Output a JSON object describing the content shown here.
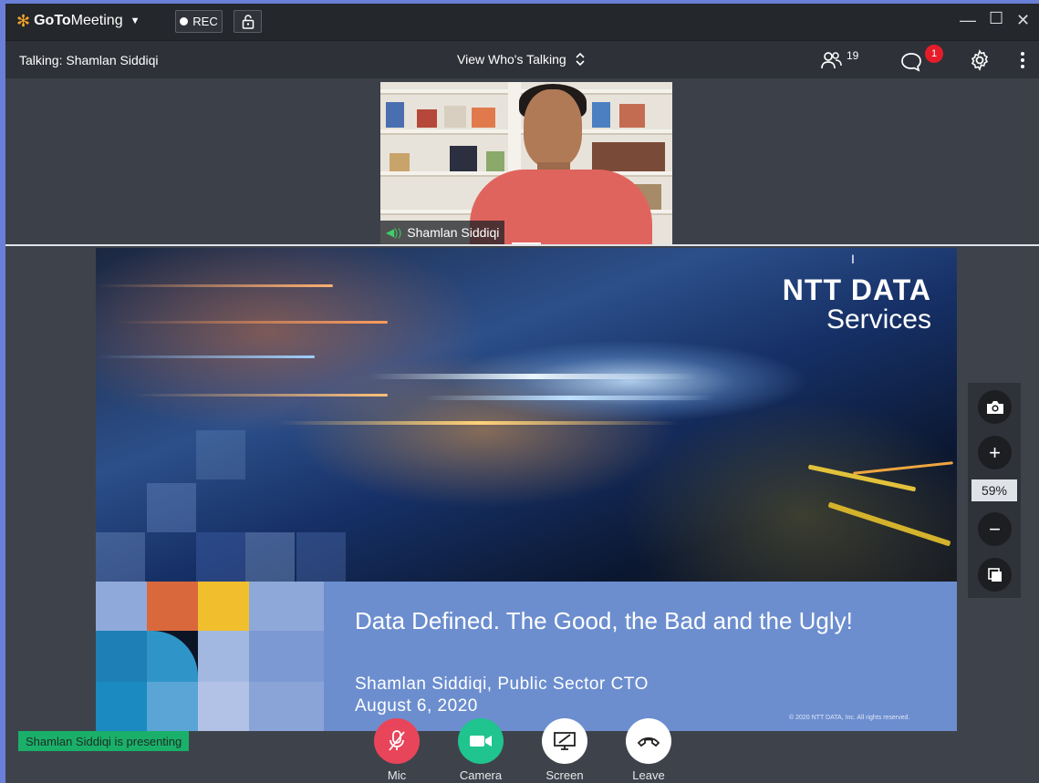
{
  "app": {
    "logo_prefix": "GoTo",
    "logo_suffix": "Meeting",
    "rec_label": "REC"
  },
  "subbar": {
    "talking": "Talking: Shamlan Siddiqi",
    "view_mode": "View Who's Talking",
    "attendee_count": "19",
    "chat_badge": "1"
  },
  "video": {
    "participant_name": "Shamlan Siddiqi"
  },
  "slide": {
    "brand_line1": "NTT DATA",
    "brand_line2": "Services",
    "title": "Data Defined. The Good, the Bad and the Ugly!",
    "subtitle": "Shamlan Siddiqi, Public Sector CTO",
    "date": "August 6, 2020",
    "copyright": "© 2020 NTT DATA, Inc. All rights reserved."
  },
  "zoom": {
    "percent": "59%"
  },
  "presenting": "Shamlan Siddiqi is presenting",
  "controls": {
    "mic": "Mic",
    "camera": "Camera",
    "screen": "Screen",
    "leave": "Leave"
  },
  "colors": {
    "mic": "#e8455a",
    "camera": "#1fc48f",
    "screen": "#ffffff",
    "leave": "#ffffff",
    "accent": "#f5a623"
  }
}
